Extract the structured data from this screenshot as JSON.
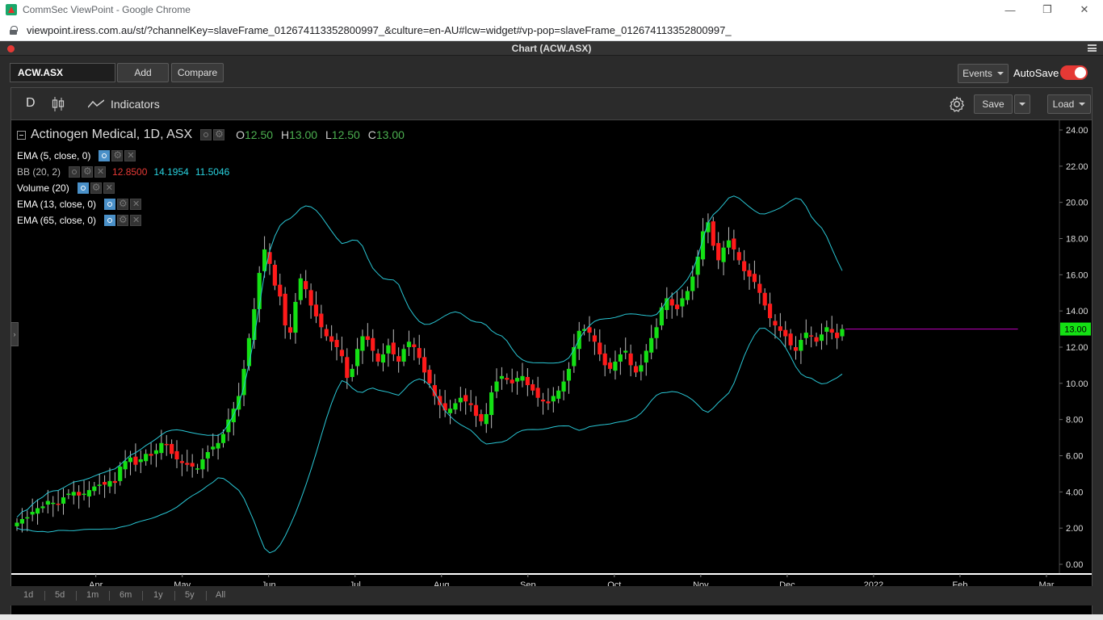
{
  "browser": {
    "tab_title": "CommSec ViewPoint - Google Chrome",
    "url": "viewpoint.iress.com.au/st/?channelKey=slaveFrame_012674113352800997_&culture=en-AU#lcw=widget#vp-pop=slaveFrame_012674113352800997_"
  },
  "window": {
    "title": "Chart (ACW.ASX)"
  },
  "toolbar": {
    "symbol_value": "ACW.ASX",
    "add_label": "Add",
    "compare_label": "Compare",
    "events_label": "Events",
    "autosave_label": "AutoSave",
    "autosave_on": true
  },
  "chart_toolbar": {
    "interval_label": "D",
    "indicators_label": "Indicators",
    "save_label": "Save",
    "load_label": "Load"
  },
  "legend": {
    "title": "Actinogen Medical, 1D, ASX",
    "ohlc": {
      "o_key": "O",
      "o": "12.50",
      "h_key": "H",
      "h": "13.00",
      "l_key": "L",
      "l": "12.50",
      "c_key": "C",
      "c": "13.00"
    },
    "indicators": [
      {
        "label": "EMA (5, close, 0)",
        "visible": true
      },
      {
        "label": "BB (20, 2)",
        "visible": false,
        "values": [
          "12.8500",
          "14.1954",
          "11.5046"
        ],
        "value_colors": [
          "#e53935",
          "#29d3e0",
          "#29d3e0"
        ]
      },
      {
        "label": "Volume (20)",
        "visible": true
      },
      {
        "label": "EMA (13, close, 0)",
        "visible": true
      },
      {
        "label": "EMA (65, close, 0)",
        "visible": true
      }
    ]
  },
  "time_frames": [
    "1d",
    "5d",
    "1m",
    "6m",
    "1y",
    "5y",
    "All"
  ],
  "colors": {
    "up": "#14e014",
    "down": "#ff1a1a",
    "bollinger": "#29c6d4",
    "last_price_line": "#c000c0",
    "last_price_badge": "#14e014",
    "autosave_toggle": "#e53935"
  },
  "chart_data": {
    "type": "candlestick",
    "title": "Actinogen Medical, 1D, ASX",
    "y_ticks": [
      "24.00",
      "22.00",
      "20.00",
      "18.00",
      "16.00",
      "14.00",
      "12.00",
      "10.00",
      "8.00",
      "6.00",
      "4.00",
      "2.00",
      "0.00"
    ],
    "ylim": [
      0,
      24
    ],
    "x_ticks": [
      {
        "label": "Apr",
        "x": 3.85
      },
      {
        "label": "May",
        "x": 4.85
      },
      {
        "label": "Jun",
        "x": 5.85
      },
      {
        "label": "Jul",
        "x": 6.85
      },
      {
        "label": "Aug",
        "x": 7.85
      },
      {
        "label": "Sep",
        "x": 8.85
      },
      {
        "label": "Oct",
        "x": 9.85
      },
      {
        "label": "Nov",
        "x": 10.85
      },
      {
        "label": "Dec",
        "x": 11.85
      },
      {
        "label": "2022",
        "x": 12.85
      },
      {
        "label": "Feb",
        "x": 13.85
      },
      {
        "label": "Mar",
        "x": 14.85
      }
    ],
    "xlim": [
      2.9,
      15.0
    ],
    "last_price": "13.00",
    "last_price_value": 13.0,
    "last_price_line_end": 14.52,
    "closes": [
      2.3,
      2.5,
      2.6,
      2.9,
      3.1,
      3.2,
      3.5,
      3.4,
      3.3,
      3.7,
      3.9,
      4.0,
      3.8,
      3.9,
      4.1,
      4.3,
      4.4,
      4.4,
      4.6,
      4.5,
      5.4,
      5.7,
      5.9,
      5.5,
      5.8,
      6.1,
      6.0,
      6.3,
      6.7,
      6.6,
      6.1,
      5.8,
      5.6,
      5.5,
      5.4,
      5.3,
      5.8,
      6.2,
      6.5,
      6.7,
      7.2,
      8.0,
      8.6,
      9.3,
      10.8,
      12.5,
      14.1,
      16.1,
      17.4,
      16.6,
      15.4,
      14.8,
      13.2,
      12.8,
      14.5,
      15.8,
      15.2,
      14.3,
      13.7,
      13.1,
      12.6,
      12.3,
      12.0,
      11.5,
      10.3,
      10.8,
      11.9,
      12.6,
      12.4,
      11.8,
      11.2,
      11.6,
      12.1,
      11.6,
      11.2,
      11.9,
      12.3,
      12.0,
      11.4,
      10.6,
      10.0,
      9.3,
      8.8,
      8.5,
      8.6,
      8.9,
      9.2,
      9.0,
      8.8,
      8.2,
      7.9,
      8.3,
      9.5,
      10.1,
      10.4,
      10.2,
      10.0,
      10.3,
      10.4,
      9.9,
      9.6,
      9.2,
      9.0,
      8.9,
      9.3,
      9.6,
      10.1,
      10.8,
      12.0,
      12.9,
      13.0,
      12.8,
      12.3,
      11.6,
      11.0,
      10.8,
      11.2,
      11.6,
      11.8,
      11.0,
      10.6,
      11.0,
      11.8,
      12.5,
      13.1,
      14.2,
      14.7,
      14.3,
      14.1,
      14.7,
      15.1,
      15.9,
      17.0,
      18.4,
      18.9,
      17.6,
      16.8,
      17.5,
      17.9,
      17.4,
      16.8,
      16.2,
      15.9,
      15.6,
      15.0,
      14.3,
      13.6,
      13.2,
      12.9,
      12.6,
      12.1,
      11.8,
      12.4,
      12.8,
      12.6,
      12.3,
      12.7,
      13.1,
      12.8,
      12.5,
      13.0
    ]
  }
}
